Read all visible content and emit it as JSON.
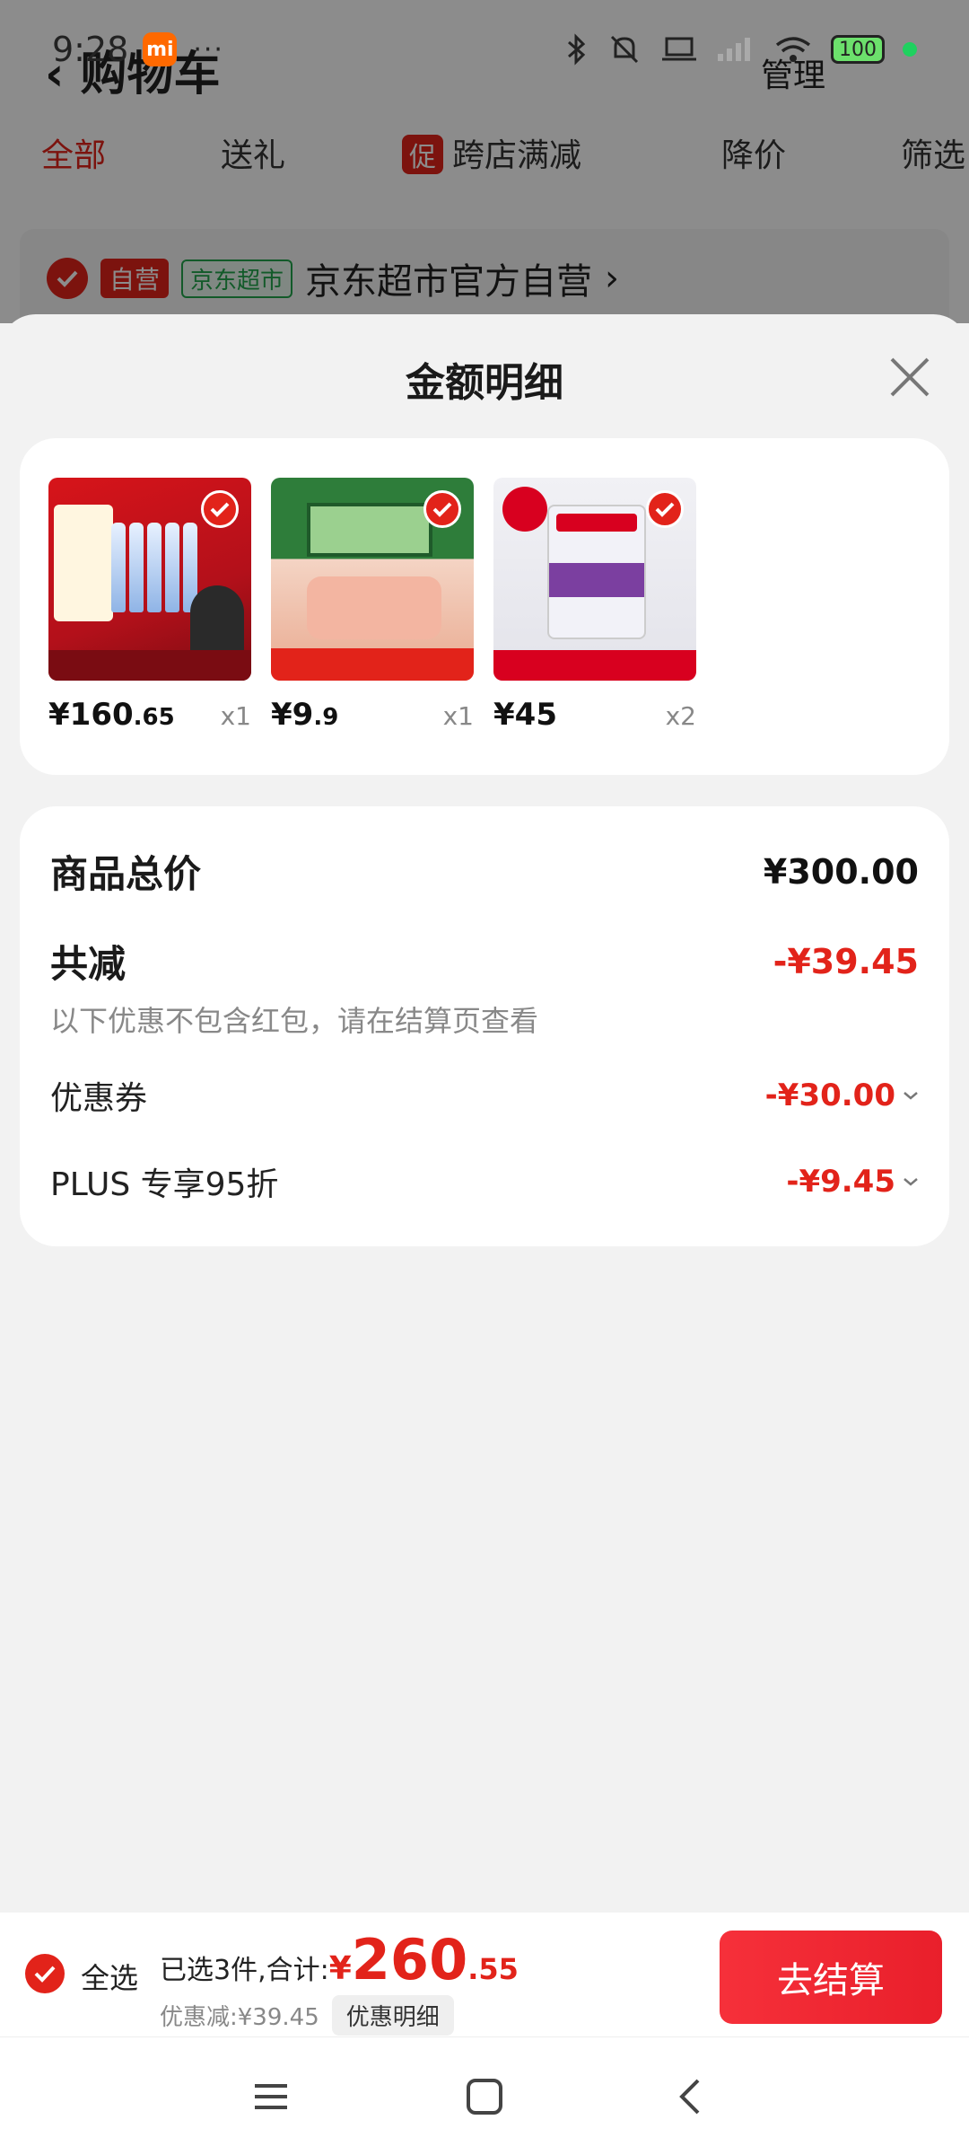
{
  "status_bar": {
    "time": "9:28",
    "mi": "mi",
    "dots": "···",
    "battery": "100"
  },
  "background": {
    "title": "购物车",
    "manage": "管理",
    "tabs": [
      "全部",
      "送礼",
      "跨店满减",
      "降价",
      "筛选"
    ],
    "promo_mark": "促",
    "store": {
      "tag_self": "自营",
      "tag_market": "京东超市",
      "name": "京东超市官方自营",
      "chevron": "›"
    }
  },
  "sheet": {
    "title": "金额明细",
    "products": [
      {
        "price_int": "¥160",
        "price_dec": ".65",
        "qty": "x1",
        "image": "erguotou-liquor"
      },
      {
        "price_int": "¥9",
        "price_dec": ".9",
        "qty": "x1",
        "image": "luncheon-meat"
      },
      {
        "price_int": "¥45",
        "price_dec": "",
        "qty": "x2",
        "image": "royal-canin-wet-food"
      }
    ],
    "summary": {
      "total_label": "商品总价",
      "total_value": "¥300.00",
      "discount_label": "共减",
      "discount_value": "-¥39.45",
      "note": "以下优惠不包含红包，请在结算页查看",
      "items": [
        {
          "label": "优惠券",
          "value": "-¥30.00"
        },
        {
          "label": "PLUS 专享95折",
          "value": "-¥9.45"
        }
      ]
    }
  },
  "checkout": {
    "select_all": "全选",
    "selected_text": "已选3件,合计:",
    "currency": "¥",
    "total_int": "260",
    "total_dec": ".55",
    "discount_text": "优惠减:¥39.45",
    "detail_button": "优惠明细",
    "checkout_button": "去结算"
  },
  "colors": {
    "accent": "#e2231a",
    "checkout": "#f6303a",
    "bg": "#f2f2f2"
  }
}
